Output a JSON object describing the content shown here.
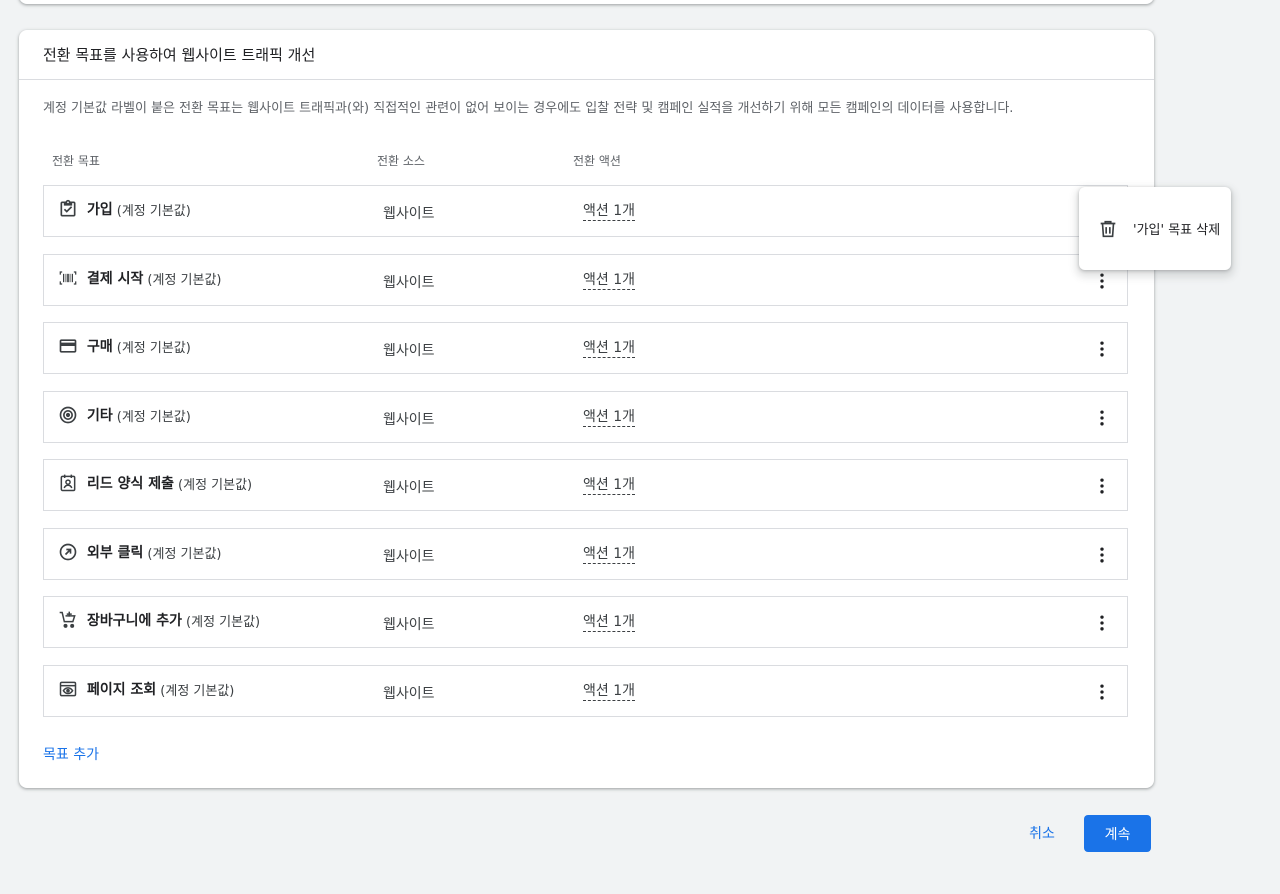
{
  "card": {
    "title": "전환 목표를 사용하여 웹사이트 트래픽 개선",
    "description": "계정 기본값 라벨이 붙은 전환 목표는 웹사이트 트래픽과(와) 직접적인 관련이 없어 보이는 경우에도 입찰 전략 및 캠페인 실적을 개선하기 위해 모든 캠페인의 데이터를 사용합니다.",
    "columns": {
      "goal": "전환 목표",
      "source": "전환 소스",
      "action": "전환 액션"
    },
    "rows": [
      {
        "name": "가입",
        "suffix": "(계정 기본값)",
        "source": "웹사이트",
        "action": "액션 1개",
        "icon": "checklist-icon"
      },
      {
        "name": "결제 시작",
        "suffix": "(계정 기본값)",
        "source": "웹사이트",
        "action": "액션 1개",
        "icon": "barcode-scanner-icon"
      },
      {
        "name": "구매",
        "suffix": "(계정 기본값)",
        "source": "웹사이트",
        "action": "액션 1개",
        "icon": "credit-card-icon"
      },
      {
        "name": "기타",
        "suffix": "(계정 기본값)",
        "source": "웹사이트",
        "action": "액션 1개",
        "icon": "target-icon"
      },
      {
        "name": "리드 양식 제출",
        "suffix": "(계정 기본값)",
        "source": "웹사이트",
        "action": "액션 1개",
        "icon": "contact-form-icon"
      },
      {
        "name": "외부 클릭",
        "suffix": "(계정 기본값)",
        "source": "웹사이트",
        "action": "액션 1개",
        "icon": "outbound-arrow-icon"
      },
      {
        "name": "장바구니에 추가",
        "suffix": "(계정 기본값)",
        "source": "웹사이트",
        "action": "액션 1개",
        "icon": "add-to-cart-icon"
      },
      {
        "name": "페이지 조회",
        "suffix": "(계정 기본값)",
        "source": "웹사이트",
        "action": "액션 1개",
        "icon": "page-view-icon"
      }
    ],
    "add_goal": "목표 추가"
  },
  "popup": {
    "label": "'가입' 목표 삭제",
    "icon": "trash-icon"
  },
  "footer": {
    "cancel": "취소",
    "continue": "계속"
  },
  "colors": {
    "accent": "#1a73e8",
    "background": "#f1f3f4"
  }
}
